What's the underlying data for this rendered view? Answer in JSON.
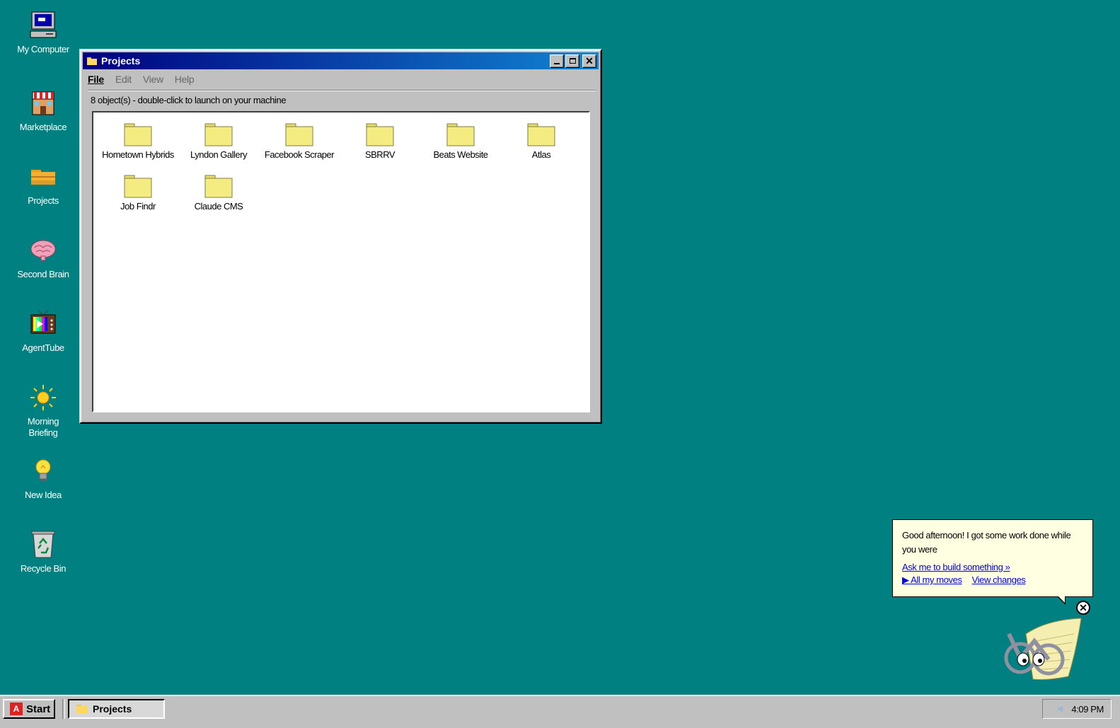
{
  "desktop": {
    "icons": [
      {
        "label": "My Computer",
        "icon": "computer-icon"
      },
      {
        "label": "Marketplace",
        "icon": "store-icon"
      },
      {
        "label": "Projects",
        "icon": "folder-icon"
      },
      {
        "label": "Second Brain",
        "icon": "brain-icon"
      },
      {
        "label": "AgentTube",
        "icon": "tv-icon"
      },
      {
        "label": "Morning Briefing",
        "icon": "sun-icon"
      },
      {
        "label": "New Idea",
        "icon": "lightbulb-icon"
      },
      {
        "label": "Recycle Bin",
        "icon": "recycle-bin-icon"
      }
    ]
  },
  "window": {
    "title": "Projects",
    "menu": [
      "File",
      "Edit",
      "View",
      "Help"
    ],
    "status": "8 object(s) - double-click to launch on your machine",
    "folders": [
      "Hometown Hybrids",
      "Lyndon Gallery",
      "Facebook Scraper",
      "SBRRV",
      "Beats Website",
      "Atlas",
      "Job Findr",
      "Claude CMS"
    ]
  },
  "balloon": {
    "message": "Good afternoon! I got some work done while you were",
    "link_build": "Ask me to build something »",
    "link_moves": "▶ All my moves",
    "link_changes": "View changes"
  },
  "taskbar": {
    "start_label": "Start",
    "task_label": "Projects",
    "clock": "4:09 PM"
  },
  "colors": {
    "desktop": "#008080",
    "titlebar_start": "#000080",
    "titlebar_end": "#1084d0",
    "balloon_bg": "#ffffe1"
  }
}
